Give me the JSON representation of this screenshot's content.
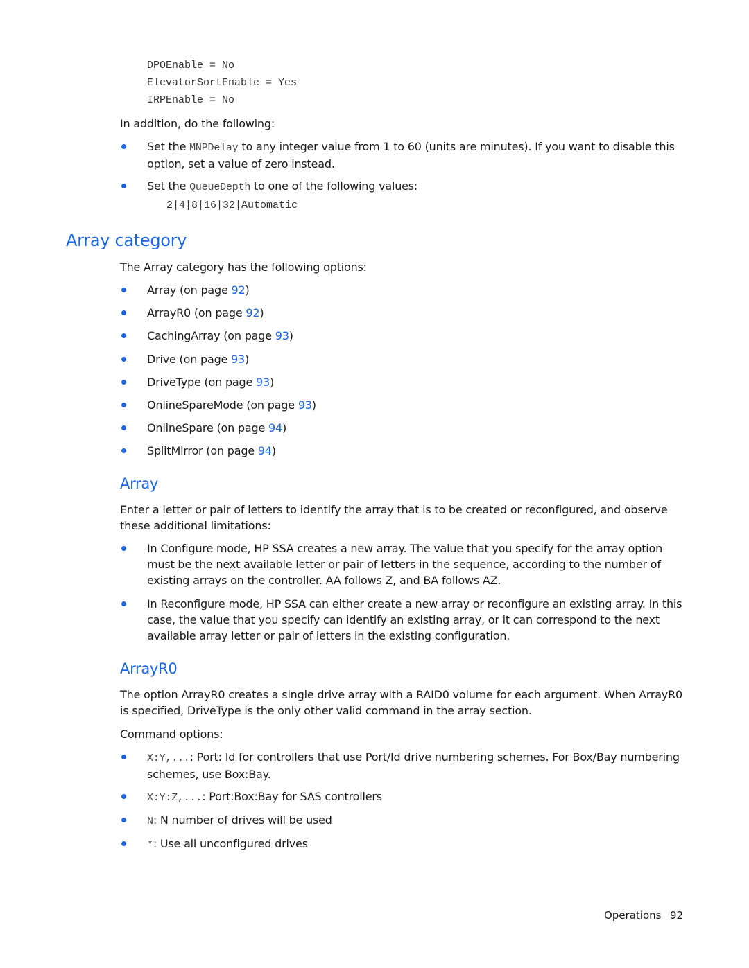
{
  "code_top": [
    "DPOEnable = No",
    "ElevatorSortEnable = Yes",
    "IRPEnable = No"
  ],
  "intro": "In addition, do the following:",
  "top_bullets": [
    {
      "pre": "Set the ",
      "code": "MNPDelay",
      "post": " to any integer value from 1 to 60 (units are minutes). If you want to disable this option, set a value of zero instead."
    },
    {
      "pre": "Set the ",
      "code": "QueueDepth",
      "post": " to one of the following values:"
    }
  ],
  "queue_values": "2|4|8|16|32|Automatic",
  "array_category": {
    "heading": "Array category",
    "intro": "The Array category has the following options:",
    "options": [
      {
        "name": "Array",
        "pre": " (on page ",
        "page": "92",
        "post": ")"
      },
      {
        "name": "ArrayR0",
        "pre": " (on page ",
        "page": "92",
        "post": ")"
      },
      {
        "name": "CachingArray",
        "pre": " (on page ",
        "page": "93",
        "post": ")"
      },
      {
        "name": "Drive",
        "pre": " (on page ",
        "page": "93",
        "post": ")"
      },
      {
        "name": "DriveType",
        "pre": " (on page ",
        "page": "93",
        "post": ")"
      },
      {
        "name": "OnlineSpareMode",
        "pre": " (on page ",
        "page": "93",
        "post": ")"
      },
      {
        "name": "OnlineSpare",
        "pre": " (on page ",
        "page": "94",
        "post": ")"
      },
      {
        "name": "SplitMirror",
        "pre": " (on page ",
        "page": "94",
        "post": ")"
      }
    ]
  },
  "array_section": {
    "heading": "Array",
    "intro": "Enter a letter or pair of letters to identify the array that is to be created or reconfigured, and observe these additional limitations:",
    "bullets": [
      "In Configure mode, HP SSA creates a new array. The value that you specify for the array option must be the next available letter or pair of letters in the sequence, according to the number of existing arrays on the controller. AA follows Z, and BA follows AZ.",
      "In Reconfigure mode, HP SSA can either create a new array or reconfigure an existing array. In this case, the value that you specify can identify an existing array, or it can correspond to the next available array letter or pair of letters in the existing configuration."
    ]
  },
  "arrayr0_section": {
    "heading": "ArrayR0",
    "intro": "The option ArrayR0 creates a single drive array with a RAID0 volume for each argument. When ArrayR0 is specified, DriveType is the only other valid command in the array section.",
    "command_label": "Command options:",
    "options": [
      {
        "code": "X:Y,...",
        "text": ": Port: Id for controllers that use Port/Id drive numbering schemes. For Box/Bay numbering schemes, use Box:Bay."
      },
      {
        "code": "X:Y:Z,...",
        "text": ": Port:Box:Bay for SAS controllers"
      },
      {
        "code": "N",
        "text": ": N number of drives will be used"
      },
      {
        "code": "*",
        "text": ": Use all unconfigured drives"
      }
    ]
  },
  "footer": {
    "section": "Operations",
    "page": "92"
  },
  "colors": {
    "accent": "#1a66e6",
    "text": "#1a1a1a"
  }
}
